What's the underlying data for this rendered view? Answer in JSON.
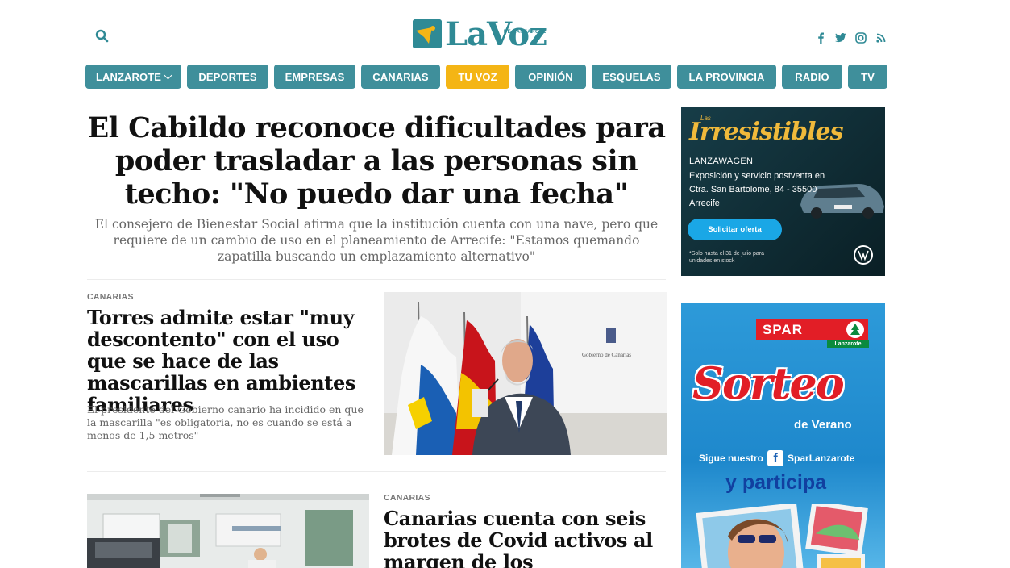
{
  "header": {
    "logo_text": "LaVoz",
    "logo_sub": "DE LANZAROTE",
    "search_icon": "search-icon",
    "social": [
      "facebook-icon",
      "twitter-icon",
      "instagram-icon",
      "rss-icon"
    ]
  },
  "nav": {
    "items": [
      {
        "label": "LANZAROTE",
        "has_dropdown": true
      },
      {
        "label": "DEPORTES"
      },
      {
        "label": "EMPRESAS"
      },
      {
        "label": "CANARIAS"
      },
      {
        "label": "TU VOZ",
        "active": true
      },
      {
        "label": "OPINIÓN"
      },
      {
        "label": "ESQUELAS"
      },
      {
        "label": "LA PROVINCIA"
      },
      {
        "label": "RADIO"
      },
      {
        "label": "TV"
      }
    ]
  },
  "main_story": {
    "headline": "El Cabildo reconoce dificultades para poder trasladar a las personas sin techo: \"No puedo dar una fecha\"",
    "summary": "El consejero de Bienestar Social afirma que la institución cuenta con una nave, pero que requiere de un cambio de uso en el planeamiento de Arrecife: \"Estamos quemando zapatilla buscando un emplazamiento alternativo\""
  },
  "story2": {
    "kicker": "CANARIAS",
    "headline": "Torres admite estar \"muy descontento\" con el uso que se hace de las mascarillas en ambientes familiares",
    "summary": "El presidente del Gobierno canario ha incidido en que la mascarilla \"es obligatoria, no es cuando se está a menos de 1,5 metros\"",
    "photo_text": "Gobierno de Canarias"
  },
  "story3": {
    "kicker": "CANARIAS",
    "headline": "Canarias cuenta con seis brotes de Covid activos al margen de los relacionados"
  },
  "ad1": {
    "small": "Las",
    "script": "Irresistibles",
    "brand": "LANZAWAGEN",
    "address": "Exposición y servicio postventa en Ctra. San Bartolomé, 84 - 35500 Arrecife",
    "cta": "Solicitar oferta",
    "fine_print": "*Solo hasta el 31 de julio para unidades en stock"
  },
  "ad2": {
    "brand": "SPAR",
    "brand_sub": "Lanzarote",
    "title": "Sorteo",
    "subtitle": "de Verano",
    "follow_prefix": "Sigue nuestro",
    "follow_handle": "SparLanzarote",
    "cta": "y participa"
  },
  "colors": {
    "nav_bg": "#3f8f9b",
    "nav_active": "#f4b515",
    "brand": "#2f8a95"
  }
}
